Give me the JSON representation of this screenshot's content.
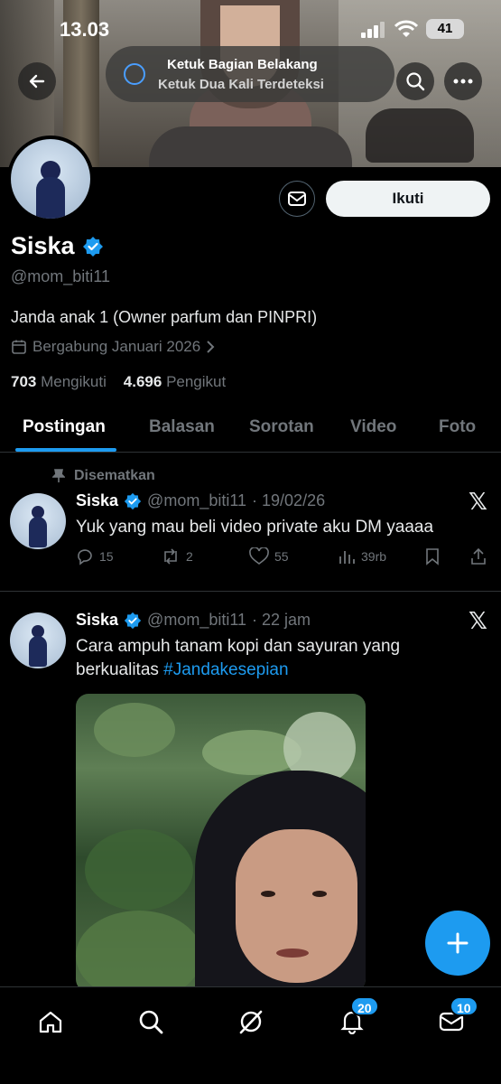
{
  "status_bar": {
    "time": "13.03",
    "battery": "41"
  },
  "accessibility_notice": {
    "line1": "Ketuk Bagian Belakang",
    "line2": "Ketuk Dua Kali Terdeteksi"
  },
  "profile": {
    "name": "Siska",
    "handle": "@mom_biti11",
    "bio": "Janda anak 1 (Owner parfum dan PINPRI)",
    "joined": "Bergabung Januari 2026",
    "following_count": "703",
    "following_label": "Mengikuti",
    "followers_count": "4.696",
    "followers_label": "Pengikut",
    "follow_label": "Ikuti"
  },
  "tabs": [
    "Postingan",
    "Balasan",
    "Sorotan",
    "Video",
    "Foto"
  ],
  "posts": [
    {
      "pinned_label": "Disematkan",
      "name": "Siska",
      "handle": "@mom_biti11",
      "time": "· 19/02/26",
      "text": "Yuk yang mau beli video private aku DM yaaaa",
      "replies": "15",
      "reposts": "2",
      "likes": "55",
      "views": "39rb"
    },
    {
      "name": "Siska",
      "handle": "@mom_biti11",
      "time": "· 22 jam",
      "text": "Cara ampuh tanam kopi dan sayuran yang berkualitas ",
      "hashtag": "#Jandakesepian"
    }
  ],
  "bottom_nav": {
    "notifications_badge": "20",
    "messages_badge": "10"
  },
  "colors": {
    "accent": "#1d9bf0",
    "background": "#000000",
    "muted": "#71767b"
  },
  "icons": [
    "back-arrow-icon",
    "accessibility-icon",
    "search-icon",
    "more-icon",
    "mail-icon",
    "verified-badge-icon",
    "calendar-icon",
    "pin-icon",
    "x-logo-icon",
    "reply-icon",
    "repost-icon",
    "like-icon",
    "views-icon",
    "bookmark-icon",
    "share-icon",
    "plus-icon",
    "home-icon",
    "grok-icon",
    "bell-icon",
    "envelope-icon"
  ]
}
